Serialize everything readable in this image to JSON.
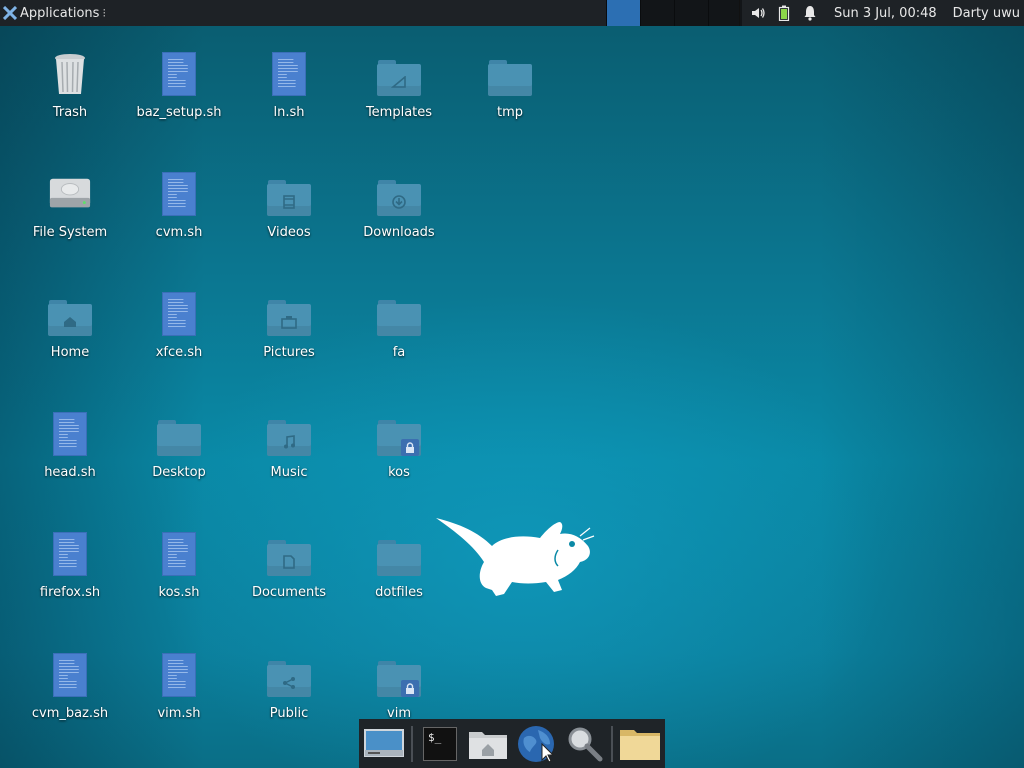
{
  "top_panel": {
    "applications_label": "Applications",
    "clock": "Sun  3 Jul, 00:48",
    "user": "Darty uwu"
  },
  "desktop_icons": [
    {
      "label": "Trash",
      "type": "trash"
    },
    {
      "label": "baz_setup.sh",
      "type": "script"
    },
    {
      "label": "ln.sh",
      "type": "script"
    },
    {
      "label": "Templates",
      "type": "folder",
      "emblem": "templates"
    },
    {
      "label": "tmp",
      "type": "folder"
    },
    {
      "label": "File System",
      "type": "drive"
    },
    {
      "label": "cvm.sh",
      "type": "script"
    },
    {
      "label": "Videos",
      "type": "folder",
      "emblem": "film"
    },
    {
      "label": "Downloads",
      "type": "folder",
      "emblem": "download"
    },
    {
      "label": "Home",
      "type": "folder",
      "emblem": "home"
    },
    {
      "label": "xfce.sh",
      "type": "script"
    },
    {
      "label": "Pictures",
      "type": "folder",
      "emblem": "camera"
    },
    {
      "label": "fa",
      "type": "folder"
    },
    {
      "label": "head.sh",
      "type": "script"
    },
    {
      "label": "Desktop",
      "type": "folder"
    },
    {
      "label": "Music",
      "type": "folder",
      "emblem": "music"
    },
    {
      "label": "kos",
      "type": "folder",
      "emblem": "lock"
    },
    {
      "label": "firefox.sh",
      "type": "script"
    },
    {
      "label": "kos.sh",
      "type": "script"
    },
    {
      "label": "Documents",
      "type": "folder",
      "emblem": "document"
    },
    {
      "label": "dotfiles",
      "type": "folder"
    },
    {
      "label": "cvm_baz.sh",
      "type": "script"
    },
    {
      "label": "vim.sh",
      "type": "script"
    },
    {
      "label": "Public",
      "type": "folder",
      "emblem": "share"
    },
    {
      "label": "vim",
      "type": "folder",
      "emblem": "lock"
    }
  ],
  "dock": {
    "items": [
      "show-desktop",
      "terminal",
      "file-manager-home",
      "web-browser",
      "app-finder",
      "folder"
    ],
    "terminal_prompt": "$_"
  },
  "colors": {
    "panel": "#1e2226",
    "active_workspace": "#2c6fb3",
    "script_icon": "#4a80cf",
    "folder_icon": "#4a92b3"
  }
}
